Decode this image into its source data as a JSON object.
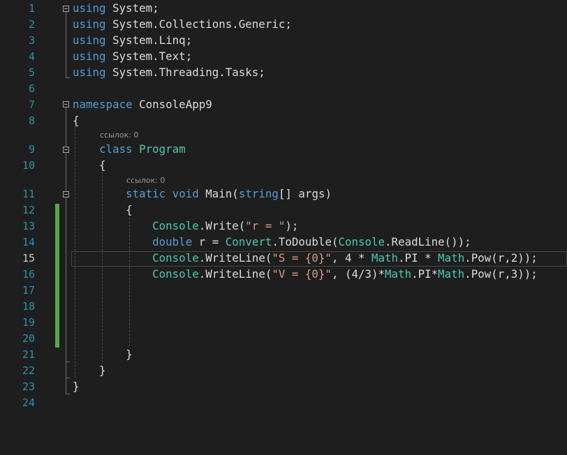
{
  "editor": {
    "line_numbers": [
      "1",
      "2",
      "3",
      "4",
      "5",
      "6",
      "7",
      "8",
      "9",
      "10",
      "11",
      "12",
      "13",
      "14",
      "15",
      "16",
      "17",
      "18",
      "19",
      "20",
      "21",
      "22",
      "23",
      "24"
    ],
    "codelens_references": "ссылок: 0",
    "lines": [
      [
        {
          "t": "using",
          "c": "kw"
        },
        {
          "t": " System;",
          "c": "ns"
        }
      ],
      [
        {
          "t": "using",
          "c": "kw"
        },
        {
          "t": " System.Collections.Generic;",
          "c": "ns"
        }
      ],
      [
        {
          "t": "using",
          "c": "kw"
        },
        {
          "t": " System.Linq;",
          "c": "ns"
        }
      ],
      [
        {
          "t": "using",
          "c": "kw"
        },
        {
          "t": " System.Text;",
          "c": "ns"
        }
      ],
      [
        {
          "t": "using",
          "c": "kw"
        },
        {
          "t": " System.Threading.Tasks;",
          "c": "ns"
        }
      ],
      [],
      [
        {
          "t": "namespace",
          "c": "kw"
        },
        {
          "t": " ConsoleApp9",
          "c": "ns"
        }
      ],
      [
        {
          "t": "{",
          "c": "ns"
        }
      ],
      [
        {
          "t": "    ",
          "c": "ns"
        },
        {
          "t": "class",
          "c": "kw"
        },
        {
          "t": " ",
          "c": "ns"
        },
        {
          "t": "Program",
          "c": "type"
        }
      ],
      [
        {
          "t": "    {",
          "c": "ns"
        }
      ],
      [
        {
          "t": "        ",
          "c": "ns"
        },
        {
          "t": "static",
          "c": "kw"
        },
        {
          "t": " ",
          "c": "ns"
        },
        {
          "t": "void",
          "c": "kw"
        },
        {
          "t": " Main(",
          "c": "ns"
        },
        {
          "t": "string",
          "c": "kw"
        },
        {
          "t": "[] args)",
          "c": "ns"
        }
      ],
      [
        {
          "t": "        {",
          "c": "ns"
        }
      ],
      [
        {
          "t": "            ",
          "c": "ns"
        },
        {
          "t": "Console",
          "c": "type"
        },
        {
          "t": ".Write(",
          "c": "ns"
        },
        {
          "t": "\"r = \"",
          "c": "str"
        },
        {
          "t": ");",
          "c": "ns"
        }
      ],
      [
        {
          "t": "            ",
          "c": "ns"
        },
        {
          "t": "double",
          "c": "kw"
        },
        {
          "t": " r = ",
          "c": "ns"
        },
        {
          "t": "Convert",
          "c": "type"
        },
        {
          "t": ".ToDouble(",
          "c": "ns"
        },
        {
          "t": "Console",
          "c": "type"
        },
        {
          "t": ".ReadLine());",
          "c": "ns"
        }
      ],
      [
        {
          "t": "            ",
          "c": "ns"
        },
        {
          "t": "Console",
          "c": "type"
        },
        {
          "t": ".WriteLine(",
          "c": "ns"
        },
        {
          "t": "\"S = {0}\"",
          "c": "str"
        },
        {
          "t": ", 4 * ",
          "c": "ns"
        },
        {
          "t": "Math",
          "c": "type"
        },
        {
          "t": ".PI * ",
          "c": "ns"
        },
        {
          "t": "Math",
          "c": "type"
        },
        {
          "t": ".Pow(r,2));",
          "c": "ns"
        }
      ],
      [
        {
          "t": "            ",
          "c": "ns"
        },
        {
          "t": "Console",
          "c": "type"
        },
        {
          "t": ".WriteLine(",
          "c": "ns"
        },
        {
          "t": "\"V = {0}\"",
          "c": "str"
        },
        {
          "t": ", (4/3)*",
          "c": "ns"
        },
        {
          "t": "Math",
          "c": "type"
        },
        {
          "t": ".PI*",
          "c": "ns"
        },
        {
          "t": "Math",
          "c": "type"
        },
        {
          "t": ".Pow(r,3));",
          "c": "ns"
        }
      ],
      [],
      [],
      [],
      [],
      [
        {
          "t": "        }",
          "c": "ns"
        }
      ],
      [
        {
          "t": "    }",
          "c": "ns"
        }
      ],
      [
        {
          "t": "}",
          "c": "ns"
        }
      ],
      []
    ],
    "current_line": "15"
  },
  "colors": {
    "background": "#1e1e1e",
    "keyword": "#569cd6",
    "type": "#4ec9b0",
    "string": "#d69d85",
    "line_number": "#2b91af",
    "change_bar": "#57a64a"
  }
}
